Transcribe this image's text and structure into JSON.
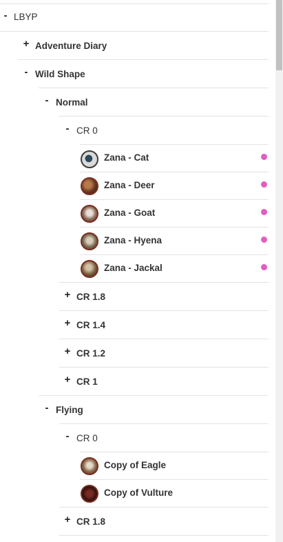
{
  "tree": {
    "root": {
      "label": "LBYP",
      "toggle": "-"
    },
    "adventure_diary": {
      "label": "Adventure Diary",
      "toggle": "+"
    },
    "wild_shape": {
      "label": "Wild Shape",
      "toggle": "-"
    },
    "normal": {
      "label": "Normal",
      "toggle": "-"
    },
    "normal_cr0": {
      "label": "CR 0",
      "toggle": "-"
    },
    "normal_items": [
      {
        "label": "Zana - Cat",
        "icon": "cat-token-icon",
        "status_color": "#e15fbe"
      },
      {
        "label": "Zana - Deer",
        "icon": "deer-token-icon",
        "status_color": "#e15fbe"
      },
      {
        "label": "Zana - Goat",
        "icon": "goat-token-icon",
        "status_color": "#e15fbe"
      },
      {
        "label": "Zana - Hyena",
        "icon": "hyena-token-icon",
        "status_color": "#e15fbe"
      },
      {
        "label": "Zana - Jackal",
        "icon": "jackal-token-icon",
        "status_color": "#e15fbe"
      }
    ],
    "normal_cr_1_8": {
      "label": "CR 1.8",
      "toggle": "+"
    },
    "normal_cr_1_4": {
      "label": "CR 1.4",
      "toggle": "+"
    },
    "normal_cr_1_2": {
      "label": "CR 1.2",
      "toggle": "+"
    },
    "normal_cr_1": {
      "label": "CR 1",
      "toggle": "+"
    },
    "flying": {
      "label": "Flying",
      "toggle": "-"
    },
    "flying_cr0": {
      "label": "CR 0",
      "toggle": "-"
    },
    "flying_items": [
      {
        "label": "Copy of Eagle",
        "icon": "eagle-token-icon"
      },
      {
        "label": "Copy of Vulture",
        "icon": "vulture-token-icon"
      }
    ],
    "flying_cr_1_8": {
      "label": "CR 1.8",
      "toggle": "+"
    }
  }
}
